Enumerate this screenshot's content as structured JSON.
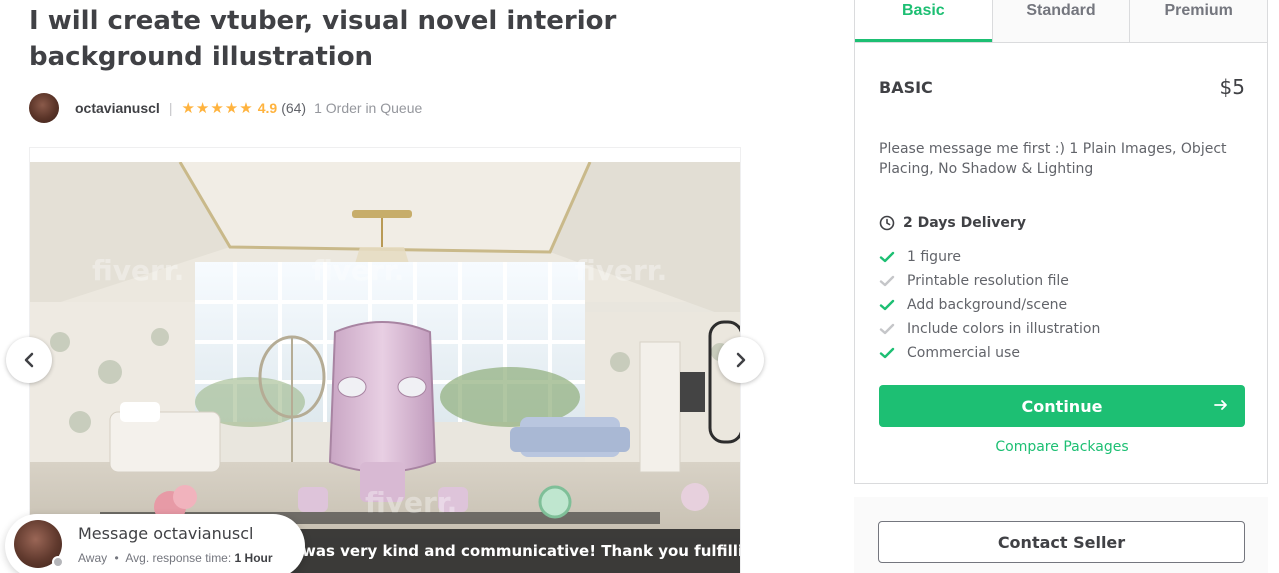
{
  "gig": {
    "title": "I will create vtuber, visual novel interior background illustration"
  },
  "seller": {
    "name": "octavianuscl",
    "stars": "★★★★★",
    "rating": "4.9",
    "review_count": "(64)",
    "queue": "1 Order in Queue"
  },
  "gallery": {
    "watermark": "fiverr.",
    "review_snippet": "was very kind and communicative! Thank you fulfillin..."
  },
  "message_card": {
    "title": "Message octavianuscl",
    "status": "Away",
    "separator": "•",
    "response_label": "Avg. response time:",
    "response_value": "1 Hour"
  },
  "packages": {
    "tabs": [
      {
        "label": "Basic",
        "active": true
      },
      {
        "label": "Standard",
        "active": false
      },
      {
        "label": "Premium",
        "active": false
      }
    ],
    "selected": {
      "name": "BASIC",
      "price": "$5",
      "description": "Please message me first :) 1 Plain Images, Object Placing, No Shadow & Lighting",
      "delivery": "2 Days Delivery",
      "features": [
        {
          "label": "1 figure",
          "included": true
        },
        {
          "label": "Printable resolution file",
          "included": false
        },
        {
          "label": "Add background/scene",
          "included": true
        },
        {
          "label": "Include colors in illustration",
          "included": false
        },
        {
          "label": "Commercial use",
          "included": true
        }
      ]
    },
    "continue_label": "Continue",
    "compare_label": "Compare Packages"
  },
  "contact": {
    "label": "Contact Seller"
  },
  "colors": {
    "brand_green": "#1dbf73",
    "star_yellow": "#ffb33e",
    "check_included": "#1dbf73",
    "check_excluded": "#c5c6c9"
  }
}
